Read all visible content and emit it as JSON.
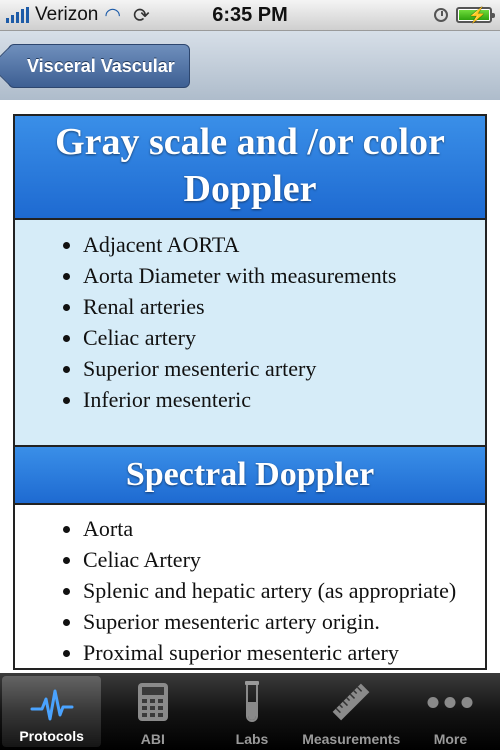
{
  "status_bar": {
    "carrier": "Verizon",
    "time": "6:35 PM"
  },
  "nav": {
    "back_label": "Visceral Vascular"
  },
  "sections": [
    {
      "title": "Gray scale and /or color Doppler",
      "items": [
        "Adjacent AORTA",
        "Aorta Diameter with measurements",
        "Renal arteries",
        "Celiac artery",
        "Superior mesenteric artery",
        "Inferior mesenteric"
      ]
    },
    {
      "title": "Spectral Doppler",
      "items": [
        "Aorta",
        "Celiac Artery",
        "Splenic and hepatic artery (as appropriate)",
        "Superior mesenteric artery origin.",
        "Proximal superior mesenteric artery"
      ]
    }
  ],
  "tabs": [
    {
      "label": "Protocols",
      "icon": "pulse-icon",
      "active": true
    },
    {
      "label": "ABI",
      "icon": "calculator-icon"
    },
    {
      "label": "Labs",
      "icon": "test-tube-icon"
    },
    {
      "label": "Measurements",
      "icon": "ruler-icon"
    },
    {
      "label": "More",
      "icon": "more-dots-icon"
    }
  ],
  "colors": {
    "header_blue": "#1e6ad1",
    "section_bg": "#d6ecf8",
    "back_button": "#3d5f93"
  }
}
